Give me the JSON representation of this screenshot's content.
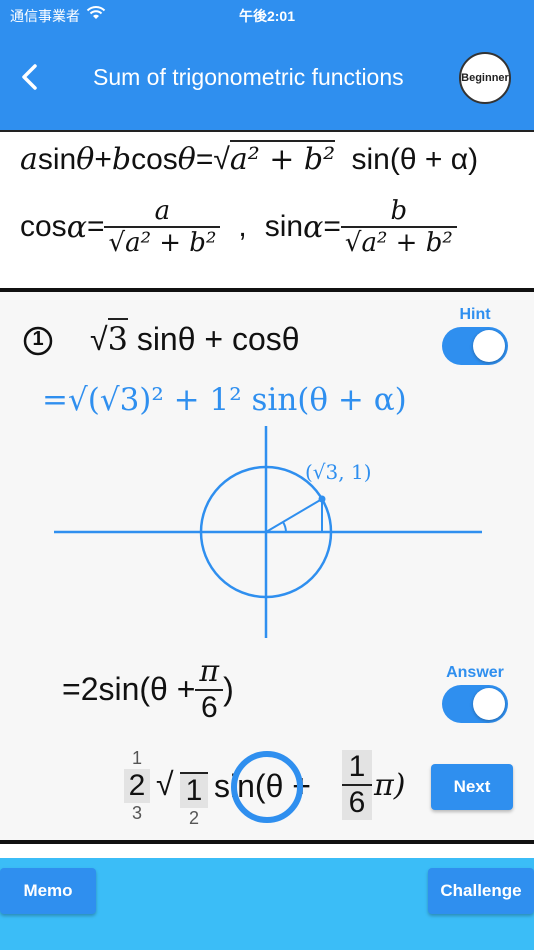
{
  "status": {
    "carrier": "通信事業者",
    "time": "午後2:01"
  },
  "header": {
    "title": "Sum of trigonometric functions",
    "badge": "Beginner"
  },
  "formula": {
    "main_lhs_a": "a",
    "main_lhs_sin": "sin",
    "main_theta1": "θ",
    "main_plus": "+",
    "main_b": "b",
    "main_cos": "cos",
    "main_theta2": "θ",
    "main_eq": "=",
    "main_sqrt_body": "a² + b²",
    "main_rhs": "sin(θ + α)",
    "cos_label": "cos",
    "alpha1": "α",
    "eq1": "=",
    "frac1_num": "a",
    "frac1_den": "a² + b²",
    "comma": ",",
    "sin_label": "sin",
    "alpha2": "α",
    "eq2": "=",
    "frac2_num": "b",
    "frac2_den": "a² + b²"
  },
  "problem": {
    "number": "1",
    "expr_sqrt": "3",
    "expr_rest": "sinθ + cosθ",
    "hint_label": "Hint",
    "hint_line": "=√(√3)² + 1² sin(θ + α)",
    "point_label": "(√3, 1)",
    "answer_prefix": "=2sin(θ +",
    "answer_num": "π",
    "answer_den": "6",
    "answer_close": ")",
    "answer_label": "Answer"
  },
  "input_row": {
    "c1_top": "1",
    "c1_mid": "2",
    "c1_bot": "3",
    "c2_mid": "1",
    "c2_bot": "2",
    "sin_text": "sin(θ +",
    "frac_num": "1",
    "frac_den": "6",
    "pi_close": "π)"
  },
  "buttons": {
    "next": "Next",
    "memo": "Memo",
    "challenge": "Challenge"
  },
  "colors": {
    "accent": "#2f8fef",
    "bottom_bar": "#3bbdf7"
  }
}
